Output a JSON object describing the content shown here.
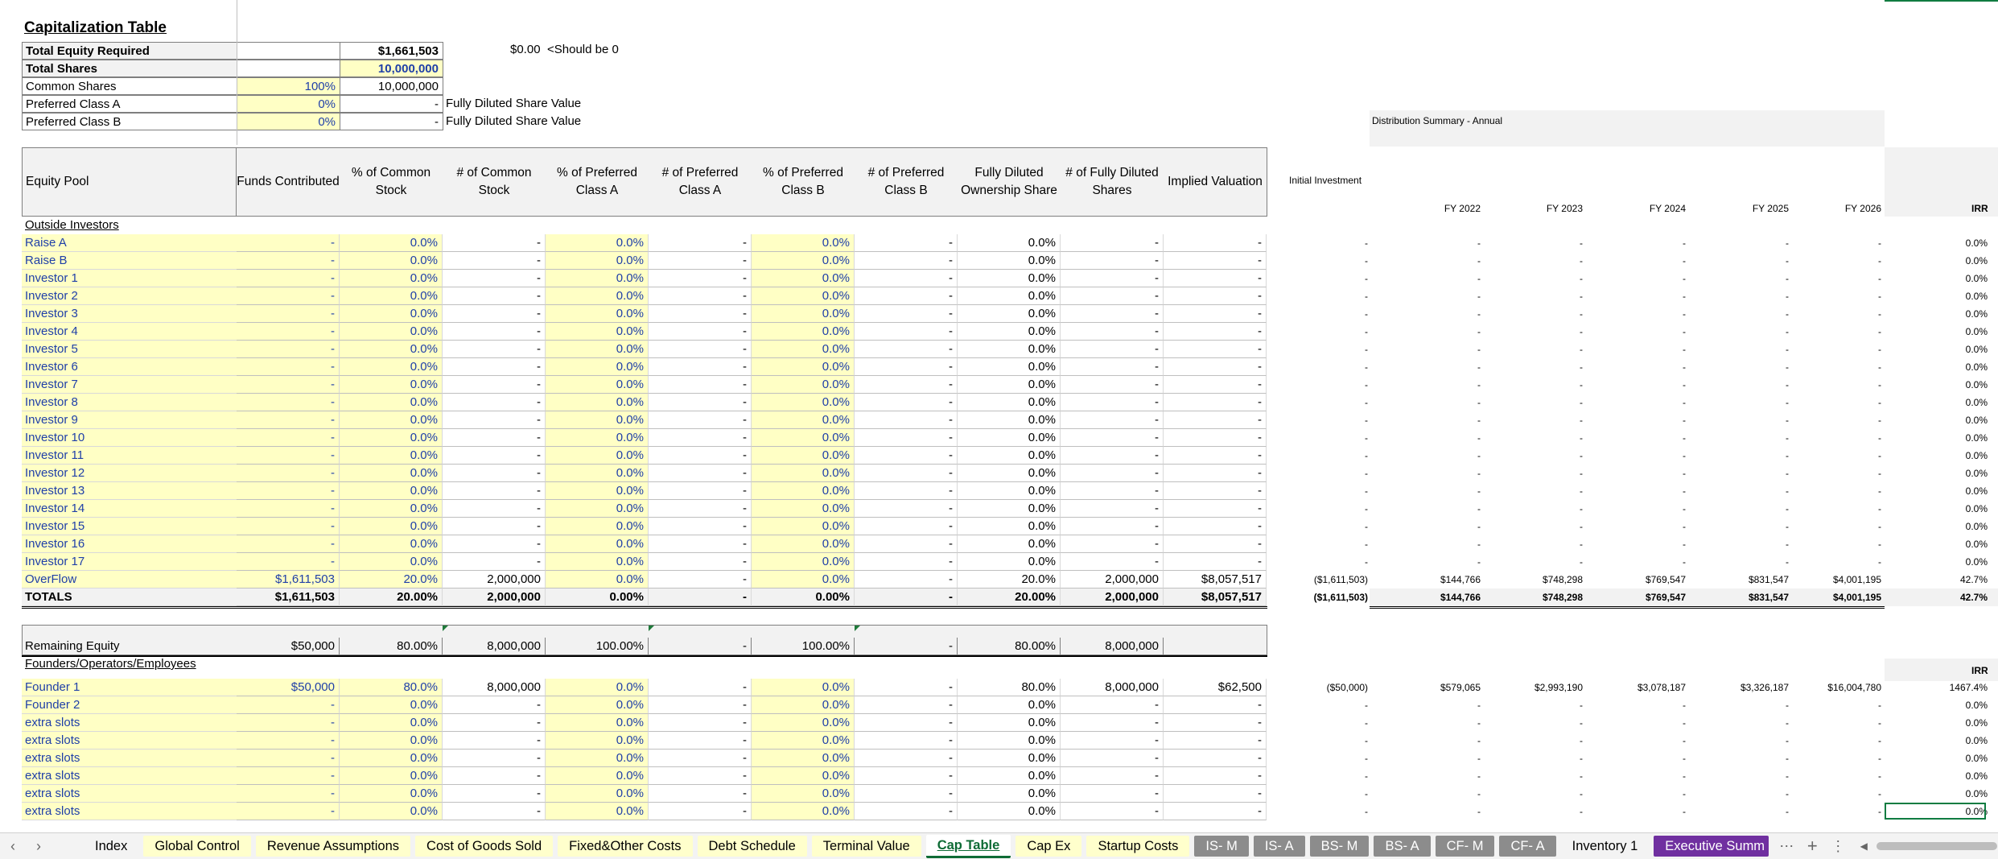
{
  "summary": {
    "title": "Capitalization Table",
    "rows": [
      {
        "label": "Total Equity Required",
        "pct": "",
        "value": "$1,661,503"
      },
      {
        "label": "Total Shares",
        "pct": "",
        "value": "10,000,000"
      },
      {
        "label": "Common Shares",
        "pct": "100%",
        "value": "10,000,000"
      },
      {
        "label": "Preferred Class A",
        "pct": "0%",
        "value": "-"
      },
      {
        "label": "Preferred Class B",
        "pct": "0%",
        "value": "-"
      }
    ],
    "check_value": "$0.00",
    "check_note": "<Should be 0",
    "fd_note_a": "Fully Diluted Share Value",
    "fd_note_b": "Fully Diluted Share Value"
  },
  "headers": {
    "equity_pool": "Equity Pool",
    "columns": [
      "Funds Contributed",
      "% of Common Stock",
      "# of Common Stock",
      "% of Preferred Class A",
      "# of Preferred Class A",
      "% of Preferred Class B",
      "# of Preferred Class B",
      "Fully Diluted Ownership Share",
      "# of Fully Diluted Shares",
      "Implied Valuation"
    ]
  },
  "outside": {
    "section_label": "Outside Investors",
    "rows": [
      {
        "name": "Raise A",
        "cells": [
          "-",
          "0.0%",
          "-",
          "0.0%",
          "-",
          "0.0%",
          "-",
          "0.0%",
          "-",
          "-"
        ],
        "dist": [
          "-",
          "-",
          "-",
          "-",
          "-",
          "-",
          "0.0%"
        ]
      },
      {
        "name": "Raise B",
        "cells": [
          "-",
          "0.0%",
          "-",
          "0.0%",
          "-",
          "0.0%",
          "-",
          "0.0%",
          "-",
          "-"
        ],
        "dist": [
          "-",
          "-",
          "-",
          "-",
          "-",
          "-",
          "0.0%"
        ]
      },
      {
        "name": "Investor 1",
        "cells": [
          "-",
          "0.0%",
          "-",
          "0.0%",
          "-",
          "0.0%",
          "-",
          "0.0%",
          "-",
          "-"
        ],
        "dist": [
          "-",
          "-",
          "-",
          "-",
          "-",
          "-",
          "0.0%"
        ]
      },
      {
        "name": "Investor 2",
        "cells": [
          "-",
          "0.0%",
          "-",
          "0.0%",
          "-",
          "0.0%",
          "-",
          "0.0%",
          "-",
          "-"
        ],
        "dist": [
          "-",
          "-",
          "-",
          "-",
          "-",
          "-",
          "0.0%"
        ]
      },
      {
        "name": "Investor 3",
        "cells": [
          "-",
          "0.0%",
          "-",
          "0.0%",
          "-",
          "0.0%",
          "-",
          "0.0%",
          "-",
          "-"
        ],
        "dist": [
          "-",
          "-",
          "-",
          "-",
          "-",
          "-",
          "0.0%"
        ]
      },
      {
        "name": "Investor 4",
        "cells": [
          "-",
          "0.0%",
          "-",
          "0.0%",
          "-",
          "0.0%",
          "-",
          "0.0%",
          "-",
          "-"
        ],
        "dist": [
          "-",
          "-",
          "-",
          "-",
          "-",
          "-",
          "0.0%"
        ]
      },
      {
        "name": "Investor 5",
        "cells": [
          "-",
          "0.0%",
          "-",
          "0.0%",
          "-",
          "0.0%",
          "-",
          "0.0%",
          "-",
          "-"
        ],
        "dist": [
          "-",
          "-",
          "-",
          "-",
          "-",
          "-",
          "0.0%"
        ]
      },
      {
        "name": "Investor 6",
        "cells": [
          "-",
          "0.0%",
          "-",
          "0.0%",
          "-",
          "0.0%",
          "-",
          "0.0%",
          "-",
          "-"
        ],
        "dist": [
          "-",
          "-",
          "-",
          "-",
          "-",
          "-",
          "0.0%"
        ]
      },
      {
        "name": "Investor 7",
        "cells": [
          "-",
          "0.0%",
          "-",
          "0.0%",
          "-",
          "0.0%",
          "-",
          "0.0%",
          "-",
          "-"
        ],
        "dist": [
          "-",
          "-",
          "-",
          "-",
          "-",
          "-",
          "0.0%"
        ]
      },
      {
        "name": "Investor 8",
        "cells": [
          "-",
          "0.0%",
          "-",
          "0.0%",
          "-",
          "0.0%",
          "-",
          "0.0%",
          "-",
          "-"
        ],
        "dist": [
          "-",
          "-",
          "-",
          "-",
          "-",
          "-",
          "0.0%"
        ]
      },
      {
        "name": "Investor 9",
        "cells": [
          "-",
          "0.0%",
          "-",
          "0.0%",
          "-",
          "0.0%",
          "-",
          "0.0%",
          "-",
          "-"
        ],
        "dist": [
          "-",
          "-",
          "-",
          "-",
          "-",
          "-",
          "0.0%"
        ]
      },
      {
        "name": "Investor 10",
        "cells": [
          "-",
          "0.0%",
          "-",
          "0.0%",
          "-",
          "0.0%",
          "-",
          "0.0%",
          "-",
          "-"
        ],
        "dist": [
          "-",
          "-",
          "-",
          "-",
          "-",
          "-",
          "0.0%"
        ]
      },
      {
        "name": "Investor 11",
        "cells": [
          "-",
          "0.0%",
          "-",
          "0.0%",
          "-",
          "0.0%",
          "-",
          "0.0%",
          "-",
          "-"
        ],
        "dist": [
          "-",
          "-",
          "-",
          "-",
          "-",
          "-",
          "0.0%"
        ]
      },
      {
        "name": "Investor 12",
        "cells": [
          "-",
          "0.0%",
          "-",
          "0.0%",
          "-",
          "0.0%",
          "-",
          "0.0%",
          "-",
          "-"
        ],
        "dist": [
          "-",
          "-",
          "-",
          "-",
          "-",
          "-",
          "0.0%"
        ]
      },
      {
        "name": "Investor 13",
        "cells": [
          "-",
          "0.0%",
          "-",
          "0.0%",
          "-",
          "0.0%",
          "-",
          "0.0%",
          "-",
          "-"
        ],
        "dist": [
          "-",
          "-",
          "-",
          "-",
          "-",
          "-",
          "0.0%"
        ]
      },
      {
        "name": "Investor 14",
        "cells": [
          "-",
          "0.0%",
          "-",
          "0.0%",
          "-",
          "0.0%",
          "-",
          "0.0%",
          "-",
          "-"
        ],
        "dist": [
          "-",
          "-",
          "-",
          "-",
          "-",
          "-",
          "0.0%"
        ]
      },
      {
        "name": "Investor 15",
        "cells": [
          "-",
          "0.0%",
          "-",
          "0.0%",
          "-",
          "0.0%",
          "-",
          "0.0%",
          "-",
          "-"
        ],
        "dist": [
          "-",
          "-",
          "-",
          "-",
          "-",
          "-",
          "0.0%"
        ]
      },
      {
        "name": "Investor 16",
        "cells": [
          "-",
          "0.0%",
          "-",
          "0.0%",
          "-",
          "0.0%",
          "-",
          "0.0%",
          "-",
          "-"
        ],
        "dist": [
          "-",
          "-",
          "-",
          "-",
          "-",
          "-",
          "0.0%"
        ]
      },
      {
        "name": "Investor 17",
        "cells": [
          "-",
          "0.0%",
          "-",
          "0.0%",
          "-",
          "0.0%",
          "-",
          "0.0%",
          "-",
          "-"
        ],
        "dist": [
          "-",
          "-",
          "-",
          "-",
          "-",
          "-",
          "0.0%"
        ]
      },
      {
        "name": "OverFlow",
        "cells": [
          "$1,611,503",
          "20.0%",
          "2,000,000",
          "0.0%",
          "-",
          "0.0%",
          "-",
          "20.0%",
          "2,000,000",
          "$8,057,517"
        ],
        "dist": [
          "($1,611,503)",
          "$144,766",
          "$748,298",
          "$769,547",
          "$831,547",
          "$4,001,195",
          "42.7%"
        ]
      }
    ],
    "totals": {
      "name": "TOTALS",
      "cells": [
        "$1,611,503",
        "20.00%",
        "2,000,000",
        "0.00%",
        "-",
        "0.00%",
        "-",
        "20.00%",
        "2,000,000",
        "$8,057,517"
      ],
      "dist": [
        "($1,611,503)",
        "$144,766",
        "$748,298",
        "$769,547",
        "$831,547",
        "$4,001,195",
        "42.7%"
      ]
    }
  },
  "remaining": {
    "label": "Remaining Equity",
    "cells": [
      "$50,000",
      "80.00%",
      "8,000,000",
      "100.00%",
      "-",
      "100.00%",
      "-",
      "80.00%",
      "8,000,000",
      ""
    ],
    "section_label": "Founders/Operators/Employees",
    "irr_label": "IRR",
    "rows": [
      {
        "name": "Founder 1",
        "cells": [
          "$50,000",
          "80.0%",
          "8,000,000",
          "0.0%",
          "-",
          "0.0%",
          "-",
          "80.0%",
          "8,000,000",
          "$62,500"
        ],
        "dist": [
          "($50,000)",
          "$579,065",
          "$2,993,190",
          "$3,078,187",
          "$3,326,187",
          "$16,004,780",
          "1467.4%"
        ]
      },
      {
        "name": "Founder 2",
        "cells": [
          "-",
          "0.0%",
          "-",
          "0.0%",
          "-",
          "0.0%",
          "-",
          "0.0%",
          "-",
          "-"
        ],
        "dist": [
          "-",
          "-",
          "-",
          "-",
          "-",
          "-",
          "0.0%"
        ]
      },
      {
        "name": "extra slots",
        "cells": [
          "-",
          "0.0%",
          "-",
          "0.0%",
          "-",
          "0.0%",
          "-",
          "0.0%",
          "-",
          "-"
        ],
        "dist": [
          "-",
          "-",
          "-",
          "-",
          "-",
          "-",
          "0.0%"
        ]
      },
      {
        "name": "extra slots",
        "cells": [
          "-",
          "0.0%",
          "-",
          "0.0%",
          "-",
          "0.0%",
          "-",
          "0.0%",
          "-",
          "-"
        ],
        "dist": [
          "-",
          "-",
          "-",
          "-",
          "-",
          "-",
          "0.0%"
        ]
      },
      {
        "name": "extra slots",
        "cells": [
          "-",
          "0.0%",
          "-",
          "0.0%",
          "-",
          "0.0%",
          "-",
          "0.0%",
          "-",
          "-"
        ],
        "dist": [
          "-",
          "-",
          "-",
          "-",
          "-",
          "-",
          "0.0%"
        ]
      },
      {
        "name": "extra slots",
        "cells": [
          "-",
          "0.0%",
          "-",
          "0.0%",
          "-",
          "0.0%",
          "-",
          "0.0%",
          "-",
          "-"
        ],
        "dist": [
          "-",
          "-",
          "-",
          "-",
          "-",
          "-",
          "0.0%"
        ]
      },
      {
        "name": "extra slots",
        "cells": [
          "-",
          "0.0%",
          "-",
          "0.0%",
          "-",
          "0.0%",
          "-",
          "0.0%",
          "-",
          "-"
        ],
        "dist": [
          "-",
          "-",
          "-",
          "-",
          "-",
          "-",
          "0.0%"
        ]
      },
      {
        "name": "extra slots",
        "cells": [
          "-",
          "0.0%",
          "-",
          "0.0%",
          "-",
          "0.0%",
          "-",
          "0.0%",
          "-",
          "-"
        ],
        "dist": [
          "-",
          "-",
          "-",
          "-",
          "-",
          "-",
          "0.0%"
        ]
      }
    ]
  },
  "distribution": {
    "title": "Distribution Summary - Annual",
    "initial_investment": "Initial Investment",
    "years": [
      "FY 2022",
      "FY 2023",
      "FY 2024",
      "FY 2025",
      "FY 2026"
    ],
    "irr_label": "IRR"
  },
  "tabs": [
    {
      "label": "Index",
      "style": "w"
    },
    {
      "label": "Global Control",
      "style": "y"
    },
    {
      "label": "Revenue Assumptions",
      "style": "y"
    },
    {
      "label": "Cost of Goods Sold",
      "style": "y"
    },
    {
      "label": "Fixed&Other Costs",
      "style": "y"
    },
    {
      "label": "Debt Schedule",
      "style": "y"
    },
    {
      "label": "Terminal Value",
      "style": "y"
    },
    {
      "label": "Cap Table",
      "style": "active"
    },
    {
      "label": "Cap Ex",
      "style": "y"
    },
    {
      "label": "Startup Costs",
      "style": "y"
    },
    {
      "label": "IS- M",
      "style": "g"
    },
    {
      "label": "IS- A",
      "style": "g"
    },
    {
      "label": "BS- M",
      "style": "g"
    },
    {
      "label": "BS- A",
      "style": "g"
    },
    {
      "label": "CF- M",
      "style": "g"
    },
    {
      "label": "CF- A",
      "style": "g"
    },
    {
      "label": "Inventory 1",
      "style": "w"
    },
    {
      "label": "Executive Summ",
      "style": "p"
    }
  ],
  "tabbar_icons": [
    "prev-sheet-icon",
    "next-sheet-icon",
    "more-sheets-icon",
    "add-sheet-icon",
    "options-icon",
    "scroll-left-icon"
  ]
}
